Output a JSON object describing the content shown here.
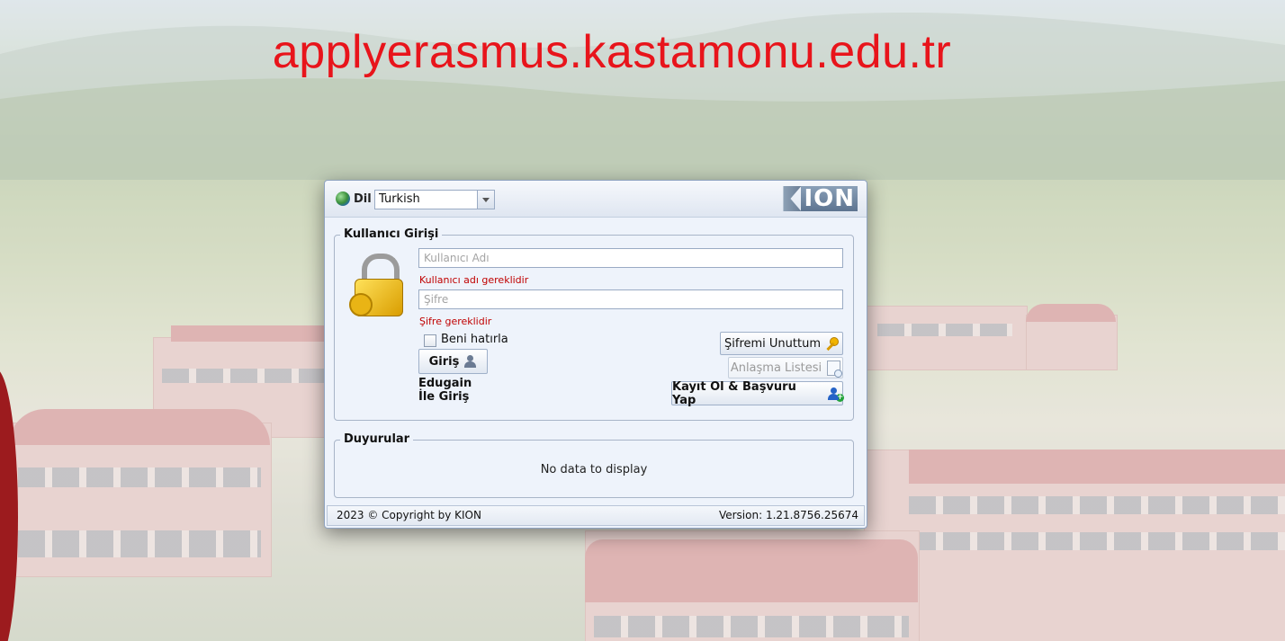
{
  "banner": {
    "domain": "applyerasmus.kastamonu.edu.tr"
  },
  "colors": {
    "domain_text": "#e8141b",
    "error_text": "#c00000",
    "panel_bg": "#eef3fb",
    "link_plus": "#22a33a"
  },
  "language": {
    "label": "Dil",
    "selected": "Turkish"
  },
  "logo": {
    "text": "ION"
  },
  "login": {
    "legend": "Kullanıcı Girişi",
    "username_placeholder": "Kullanıcı Adı",
    "username_error": "Kullanıcı adı gereklidir",
    "password_placeholder": "Şifre",
    "password_error": "Şifre gereklidir",
    "remember_me": "Beni hatırla",
    "login_button": "Giriş",
    "edugain_line1": "Edugain",
    "edugain_line2": "İle Giriş",
    "forgot_password": "Şifremi Unuttum",
    "agreement_list": "Anlaşma Listesi",
    "register_apply": "Kayıt Ol & Başvuru Yap"
  },
  "announcements": {
    "legend": "Duyurular",
    "empty": "No data to display"
  },
  "footer": {
    "copyright": "2023 © Copyright by KION",
    "version": "Version: 1.21.8756.25674"
  },
  "icons": {
    "language": "globe-icon",
    "lock": "lock-icon",
    "login": "user-icon",
    "forgot": "key-icon",
    "agreement": "document-search-icon",
    "register": "user-add-icon"
  }
}
